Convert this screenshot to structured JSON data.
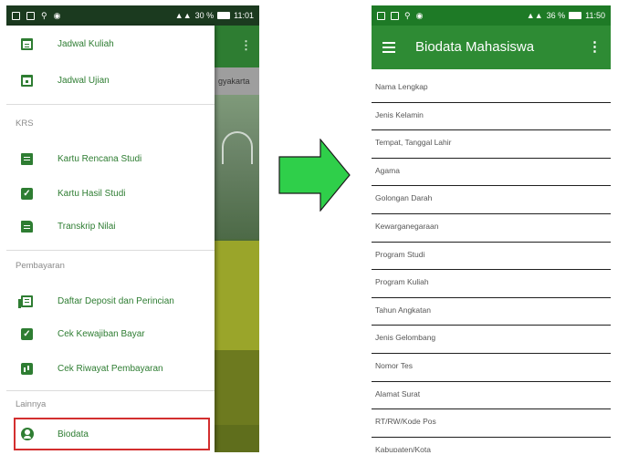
{
  "left_phone": {
    "status_bar": {
      "battery": "30 %",
      "time": "11:01"
    },
    "behind_content": {
      "tab_text": "gyakarta"
    },
    "drawer": {
      "items_top": [
        {
          "label": "Jadwal Kuliah",
          "icon": "calendar-icon"
        },
        {
          "label": "Jadwal Ujian",
          "icon": "calendar-event-icon"
        }
      ],
      "sections": [
        {
          "title": "KRS",
          "items": [
            {
              "label": "Kartu Rencana Studi",
              "icon": "clipboard-icon"
            },
            {
              "label": "Kartu Hasil Studi",
              "icon": "check-box-icon"
            },
            {
              "label": "Transkrip Nilai",
              "icon": "document-icon"
            }
          ]
        },
        {
          "title": "Pembayaran",
          "items": [
            {
              "label": "Daftar Deposit dan Perincian",
              "icon": "list-icon"
            },
            {
              "label": "Cek Kewajiban Bayar",
              "icon": "check-box-icon"
            },
            {
              "label": "Cek Riwayat Pembayaran",
              "icon": "bar-chart-icon"
            }
          ]
        },
        {
          "title": "Lainnya",
          "items": [
            {
              "label": "Biodata",
              "icon": "account-circle-icon"
            }
          ]
        }
      ]
    }
  },
  "right_phone": {
    "status_bar": {
      "battery": "36 %",
      "time": "11:50"
    },
    "app_bar": {
      "title": "Biodata Mahasiswa"
    },
    "fields": [
      "Nama Lengkap",
      "Jenis Kelamin",
      "Tempat, Tanggal Lahir",
      "Agama",
      "Golongan Darah",
      "Kewarganegaraan",
      "Program Studi",
      "Program Kuliah",
      "Tahun Angkatan",
      "Jenis Gelombang",
      "Nomor Tes",
      "Alamat Surat",
      "RT/RW/Kode Pos",
      "Kabupaten/Kota"
    ]
  },
  "colors": {
    "primary": "#2e8b34",
    "highlight_border": "#d32f2f",
    "arrow": "#2fcf4a"
  }
}
